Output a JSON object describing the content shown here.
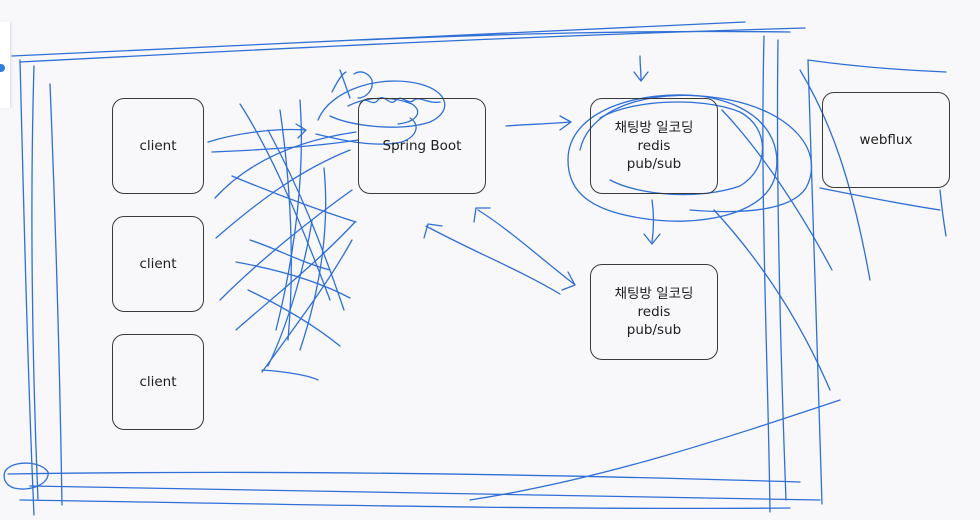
{
  "diagram": {
    "nodes": [
      {
        "id": "client-1",
        "lines": [
          "client"
        ]
      },
      {
        "id": "client-2",
        "lines": [
          "client"
        ]
      },
      {
        "id": "client-3",
        "lines": [
          "client"
        ]
      },
      {
        "id": "spring-boot",
        "lines": [
          "Spring Boot"
        ]
      },
      {
        "id": "chat-redis-1",
        "lines": [
          "채팅방 일코딩",
          "redis",
          "pub/sub"
        ]
      },
      {
        "id": "chat-redis-2",
        "lines": [
          "채팅방 일코딩",
          "redis",
          "pub/sub"
        ]
      },
      {
        "id": "webflux",
        "lines": [
          "webflux"
        ]
      }
    ]
  },
  "colors": {
    "pen": "#2f6fd6",
    "box_stroke": "#3a3a3a",
    "text": "#1e1e1e",
    "background": "#f8f8fa"
  }
}
